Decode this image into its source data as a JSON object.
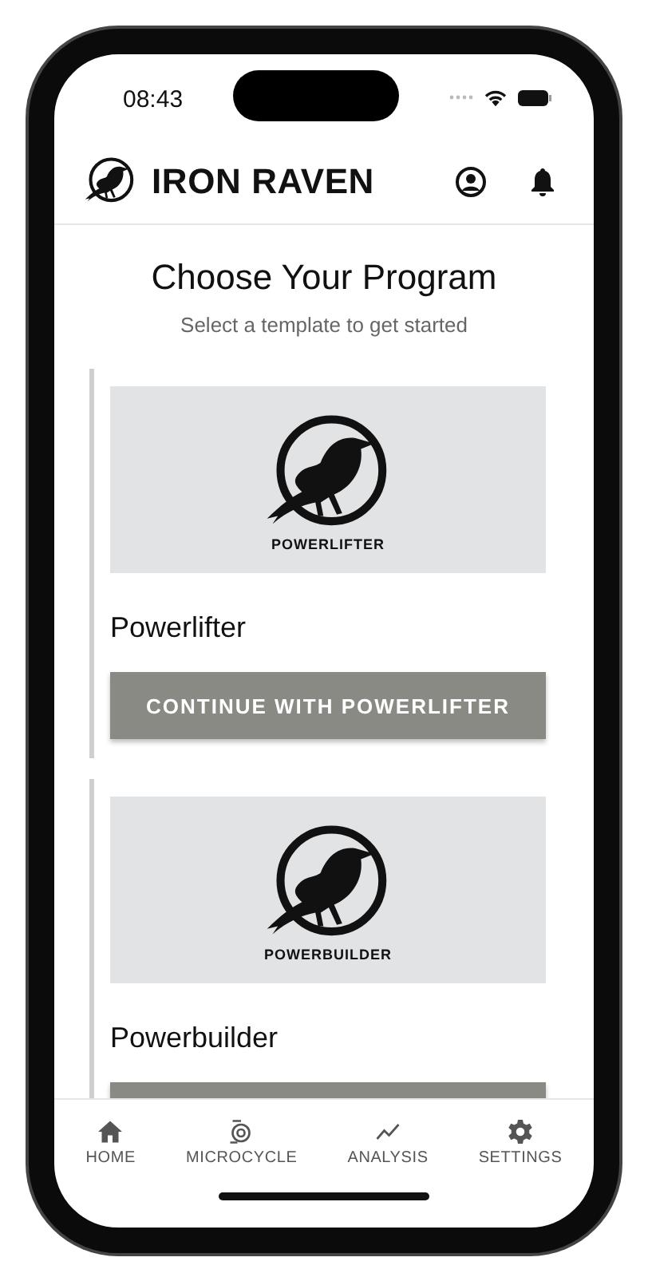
{
  "status_bar": {
    "time": "08:43"
  },
  "header": {
    "title": "IRON RAVEN"
  },
  "page": {
    "title": "Choose Your Program",
    "subtitle": "Select a template to get started"
  },
  "programs": [
    {
      "image_caption": "POWERLIFTER",
      "name": "Powerlifter",
      "button_label": "CONTINUE WITH POWERLIFTER"
    },
    {
      "image_caption": "POWERBUILDER",
      "name": "Powerbuilder"
    }
  ],
  "bottom_nav": [
    {
      "kind": "home",
      "label": "HOME"
    },
    {
      "kind": "cycle",
      "label": "MICROCYCLE"
    },
    {
      "kind": "chart",
      "label": "ANALYSIS"
    },
    {
      "kind": "gear",
      "label": "SETTINGS"
    }
  ]
}
